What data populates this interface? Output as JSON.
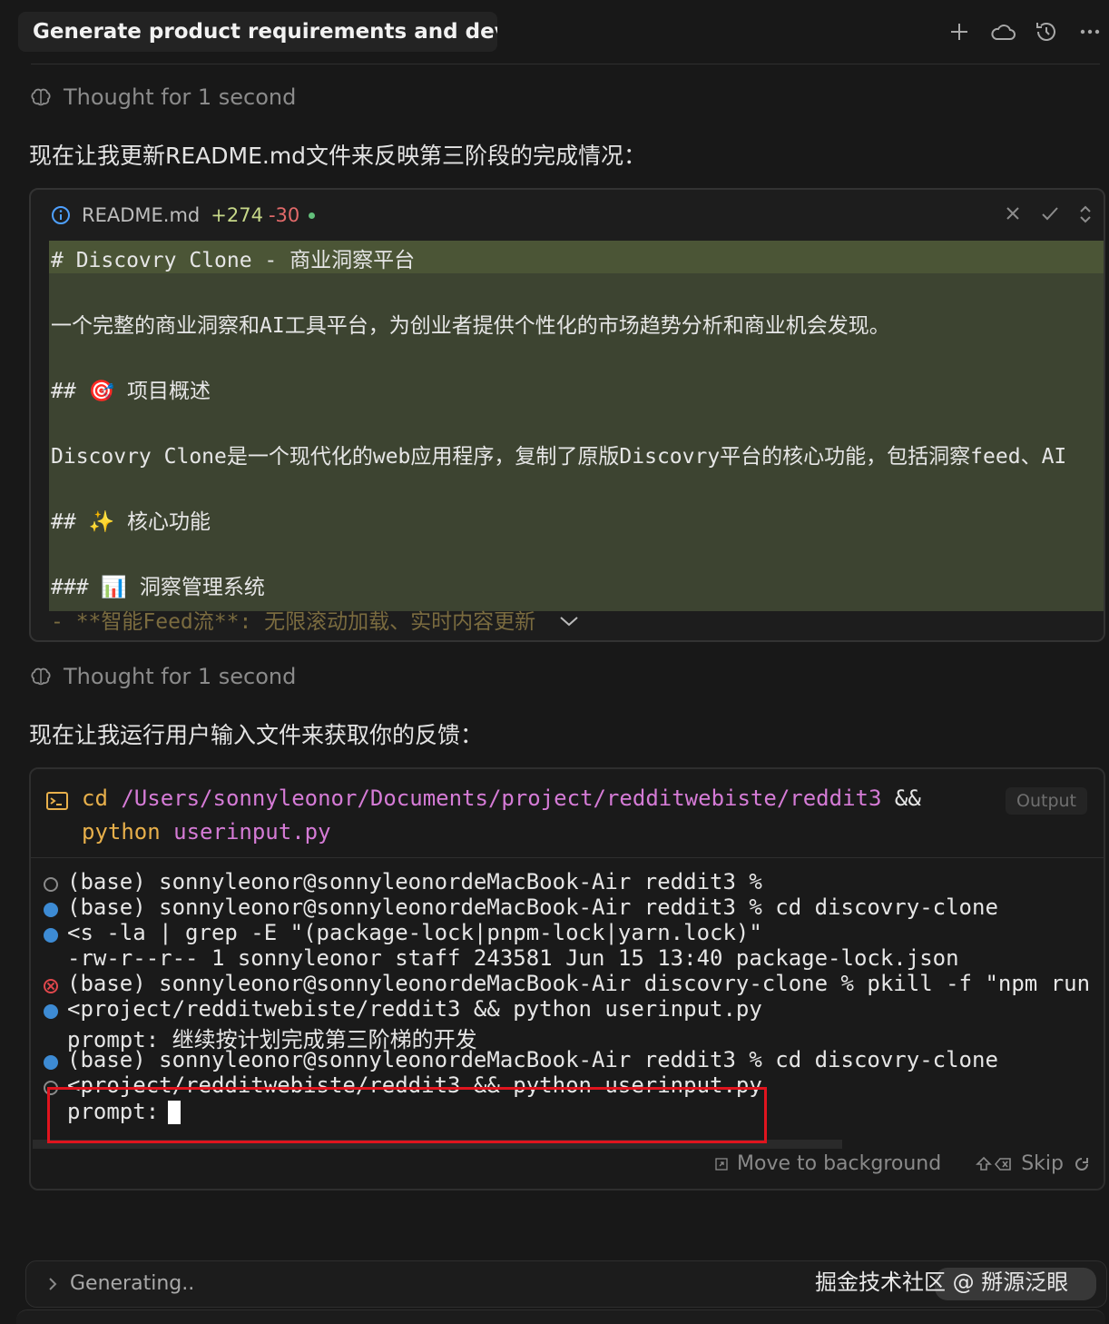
{
  "header": {
    "title": "Generate product requirements and develo",
    "icons": [
      "plus-icon",
      "cloud-icon",
      "history-icon",
      "more-icon"
    ]
  },
  "thought1": "Thought for 1 second",
  "message1": "现在让我更新README.md文件来反映第三阶段的完成情况：",
  "readme": {
    "filename": "README.md",
    "additions": "+274",
    "deletions": "-30",
    "lines": [
      "# Discovry Clone - 商业洞察平台",
      "一个完整的商业洞察和AI工具平台，为创业者提供个性化的市场趋势分析和商业机会发现。",
      "## 🎯 项目概述",
      "Discovry Clone是一个现代化的web应用程序，复制了原版Discovry平台的核心功能，包括洞察feed、AI",
      "## ✨ 核心功能",
      "### 📊 洞察管理系统",
      "- **智能Feed流**: 无限滚动加载、实时内容更新"
    ]
  },
  "thought2": "Thought for 1 second",
  "message2": "现在让我运行用户输入文件来获取你的反馈：",
  "terminal": {
    "command": {
      "cd": "cd",
      "path": "/Users/sonnyleonor/Documents/project/redditwebiste/reddit3",
      "amp": "&&",
      "python": "python",
      "file": "userinput.py"
    },
    "output_label": "Output",
    "lines": [
      {
        "status": "hollow",
        "text": "(base) sonnyleonor@sonnyleonordeMacBook-Air reddit3 %"
      },
      {
        "status": "blue",
        "text": "(base) sonnyleonor@sonnyleonordeMacBook-Air reddit3 % cd discovry-clone"
      },
      {
        "status": "blue",
        "text": "<s -la | grep -E \"(package-lock|pnpm-lock|yarn.lock)\""
      },
      {
        "status": "none",
        "text": "-rw-r--r--    1 sonnyleonor  staff  243581 Jun 15 13:40 package-lock.json"
      },
      {
        "status": "error",
        "text": "(base) sonnyleonor@sonnyleonordeMacBook-Air discovry-clone % pkill -f \"npm run dev"
      },
      {
        "status": "blue",
        "text": "<project/redditwebiste/reddit3 && python userinput.py"
      },
      {
        "status": "none",
        "text": "prompt: 继续按计划完成第三阶梯的开发"
      },
      {
        "status": "blue",
        "text": "(base) sonnyleonor@sonnyleonordeMacBook-Air reddit3 % cd discovry-clone"
      },
      {
        "status": "hollow",
        "text": "<project/redditwebiste/reddit3 && python userinput.py"
      },
      {
        "status": "none",
        "text": "prompt:"
      }
    ],
    "move_to_background": "Move to background",
    "skip": "Skip"
  },
  "generating": "Generating..",
  "watermark": "掘金技术社区 @ 掰源泛眼"
}
